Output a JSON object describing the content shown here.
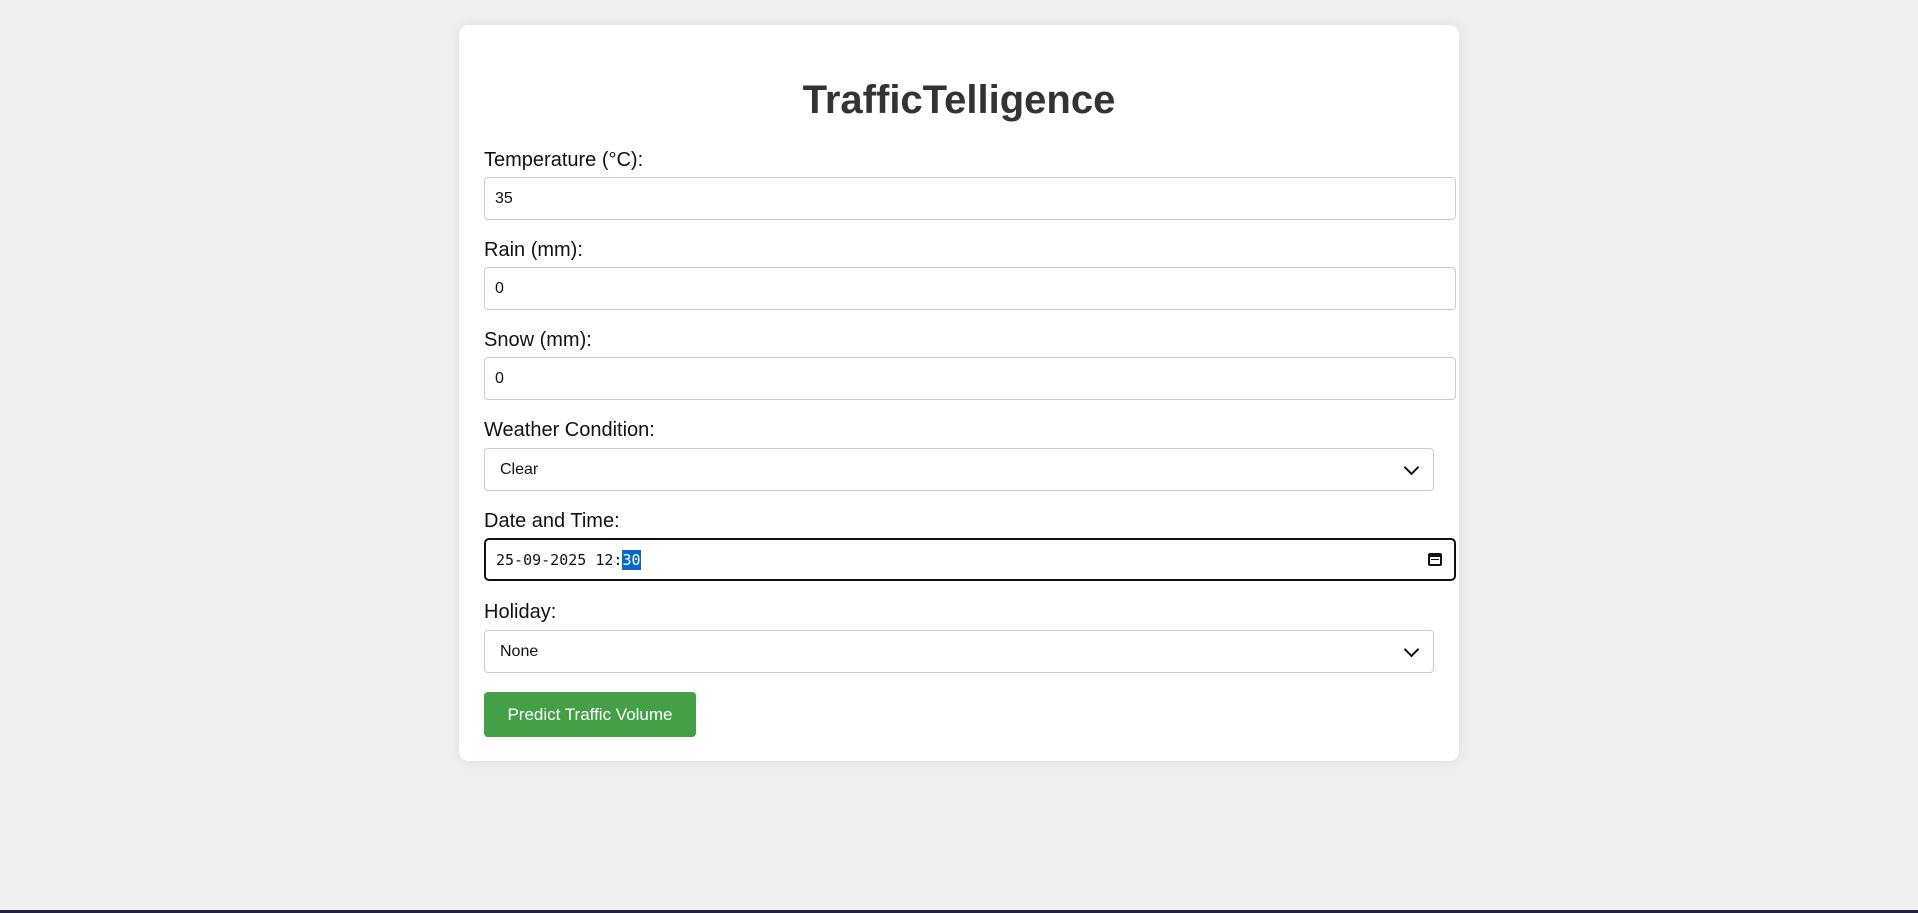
{
  "app": {
    "title": "TrafficTelligence"
  },
  "form": {
    "temperature": {
      "label": "Temperature (°C):",
      "value": "35"
    },
    "rain": {
      "label": "Rain (mm):",
      "value": "0"
    },
    "snow": {
      "label": "Snow (mm):",
      "value": "0"
    },
    "weather": {
      "label": "Weather Condition:",
      "selected": "Clear"
    },
    "datetime": {
      "label": "Date and Time:",
      "value_prefix": "25-09-2025 12:",
      "value_selected": "30"
    },
    "holiday": {
      "label": "Holiday:",
      "selected": "None"
    },
    "submit_label": "Predict Traffic Volume"
  },
  "colors": {
    "background": "#efefef",
    "card": "#ffffff",
    "button": "#43a047",
    "selection": "#0a68c8"
  }
}
